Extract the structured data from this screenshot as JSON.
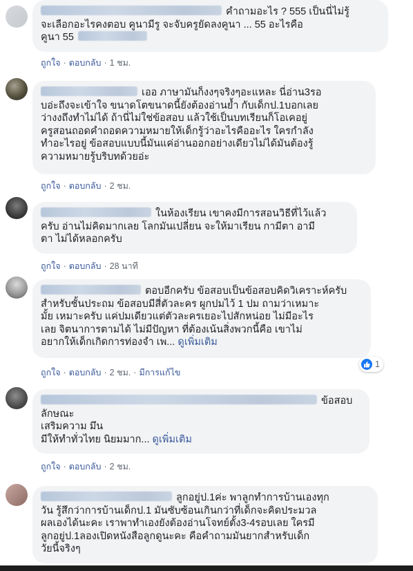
{
  "comments": [
    {
      "lines": [
        "คำถามอะไร ? 555 เป็นนี่ไม่รู้",
        "จะเลือกอะไรคงตอบ คูนามีรู จะจับครูยัดลงคูนา ... 55 อะไรคือ",
        "คูนา 55"
      ],
      "like": "ถูกใจ",
      "reply": "ตอบกลับ",
      "time": "1 ชม."
    },
    {
      "lines": [
        "เออ ภาษามันก็งงๆจริงๆอะแหละ นี่อ่าน3รอ",
        "บอ่ะถึงจะเข้าใจ ขนาดโตขนาดนี้ยังต้องอ่านย้ำ กับเด็กป.1บอกเลย",
        "ว่างงถึงทำไม่ได้ ถ้านี่ไม่ใช่ข้อสอบ แล้วใช้เป็นบทเรียนก็โอเคอยู่",
        "ครูสอนถอดคำถอดความหมายให้เด็กรู้ว่าอะไรคืออะไร ใครกำลัง",
        "ทำอะไรอยู่ ข้อสอบแบบนี้มันแค่อ่านออกอย่างเดียวไม่ได้มันต้องรู้",
        "ความหมายรู้บริบทด้วยอ่ะ"
      ],
      "like": "ถูกใจ",
      "reply": "ตอบกลับ",
      "time": "2 ชม."
    },
    {
      "lines": [
        "ในห้องเรียน เขาคงมีการสอนวิธีที่ไว้แล้ว",
        "ครับ อ่านไม่คิดมากเลย โลกมันเปลี่ยน จะให้มาเรียน กามีตา อามี",
        "ตา ไม่ได้หลอกครับ"
      ],
      "like": "ถูกใจ",
      "reply": "ตอบกลับ",
      "time": "28 นาที"
    },
    {
      "lines": [
        "ตอบอีกครับ ข้อสอบเป็นข้อสอบคิดวิเคราะห์ครับ",
        "สำหรับชั้นประถม ข้อสอบมีสี่ตัวละคร ผูกปมไว้ 1 ปม ถามว่าเหมาะ",
        "มั้ย เหมาะครับ แค่ปมเดียวแต่ตัวละครเยอะไปสักหน่อย ไม่มีอะไร",
        "เลย จิตนาการตามได้ ไม่มีปัญหา ที่ต้องเน้นสิ่งพวกนี้คือ เขาไม่",
        "อยากให้เด็กเกิดการท่องจำ เพ..."
      ],
      "see_more": "ดูเพิ่มเติม",
      "reaction_count": "1",
      "like": "ถูกใจ",
      "reply": "ตอบกลับ",
      "time": "2 ชม.",
      "edited": "มีการแก้ไข"
    },
    {
      "lines": [
        "ข้อสอบ",
        "ลักษณะ",
        "เสริมความ มึน",
        "มีให้ทำทั่วไทย นิยมมาก..."
      ],
      "see_more": "ดูเพิ่มเติม",
      "like": "ถูกใจ",
      "reply": "ตอบกลับ",
      "time": "2 ชม."
    },
    {
      "lines": [
        "ลูกอยู่ป.1ค่ะ พาลูกทำการบ้านเองทุก",
        "วัน รู้สึกว่าการบ้านเด็กป.1 มันซับซ้อนเกินกว่าที่เด็กจะคิดประมวล",
        "ผลเองได้นะคะ เราพาทำเองยังต้องอ่านโจทย์ตั้ง3-4รอบเลย ใครมี",
        "ลูกอยู่ป.1ลองเปิดหนังสือลูกดูนะคะ คือคำถามมันยากสำหรับเด็ก",
        "วัยนี้จริงๆ"
      ]
    }
  ],
  "colors": {
    "bubble": "#f2f3f5",
    "link": "#385898",
    "meta": "#606770",
    "like_badge": "#1877f2"
  },
  "icons": {
    "reaction": "thumbs-up-icon"
  }
}
